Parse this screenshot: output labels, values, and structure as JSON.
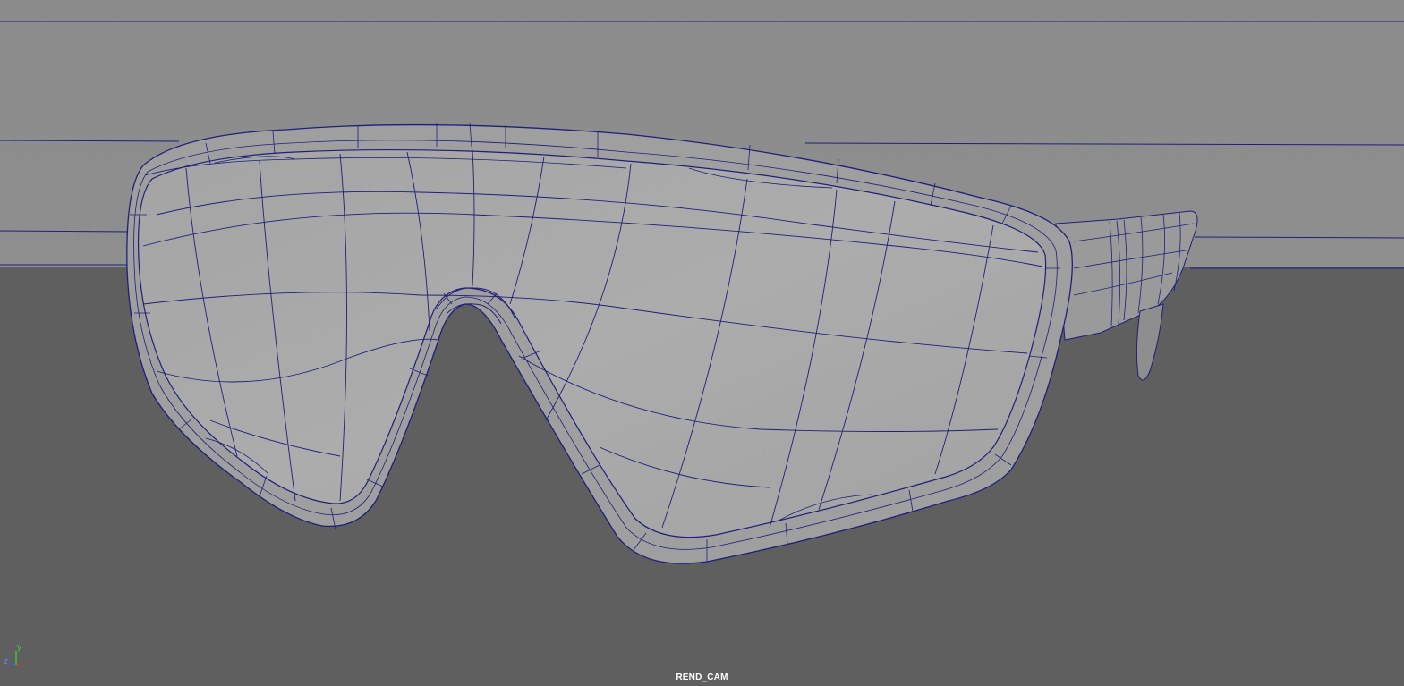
{
  "viewport": {
    "camera_name": "REND_CAM",
    "axis": {
      "y_label": "y",
      "z_label": "z"
    },
    "colors": {
      "background_upper": "#8c8c8c",
      "background_lower": "#5f5f5f",
      "mesh_fill": "#a9a9a9",
      "mesh_fill_shadow": "#8a8a8a",
      "wireframe": "#1f1f7a",
      "axis_x": "#e83030",
      "axis_y": "#30e030",
      "axis_z": "#3060ff"
    },
    "object": "sunglasses-mesh"
  }
}
